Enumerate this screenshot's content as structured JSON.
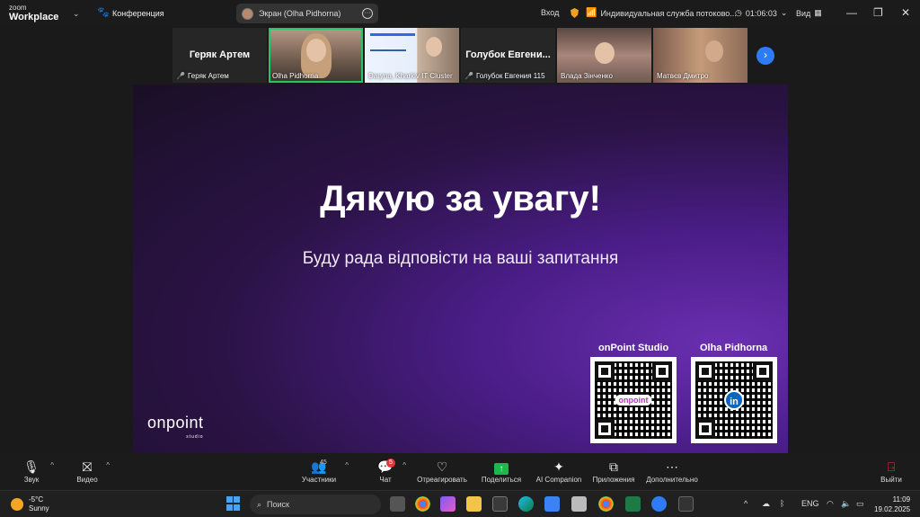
{
  "app": {
    "logo_line1": "zoom",
    "logo_line2": "Workplace"
  },
  "meeting": {
    "label": "Конференция"
  },
  "screen_share": {
    "label": "Экран (Olha Pidhorna)"
  },
  "header_right": {
    "login": "Вход",
    "service": "Индивидуальная служба потоково...",
    "timer": "01:06:03",
    "view": "Вид"
  },
  "participants_strip": [
    {
      "name": "Геряк Артем",
      "big_name": "Геряк Артем",
      "muted": true
    },
    {
      "name": "Olha Pidhorna",
      "big_name": "",
      "muted": false,
      "active": true
    },
    {
      "name": "Daryna, Kharkiv IT Cluster",
      "big_name": "",
      "muted": false
    },
    {
      "name": "Голубок Евгения 115",
      "big_name": "Голубок Евгени...",
      "muted": true
    },
    {
      "name": "Влада Зінченко",
      "big_name": "",
      "muted": false
    },
    {
      "name": "Матвєв Дмитро",
      "big_name": "",
      "muted": false
    }
  ],
  "slide": {
    "title": "Дякую за увагу!",
    "subtitle": "Буду рада відповісти на ваші запитання",
    "qr1_label": "onPoint Studio",
    "qr1_badge": "onpoint",
    "qr2_label": "Olha Pidhorna",
    "qr2_badge": "in",
    "brand": "onpoint",
    "brand_sub": "studio"
  },
  "toolbar": {
    "audio": "Звук",
    "video": "Видео",
    "participants": "Участники",
    "participants_count": "45",
    "chat": "Чат",
    "chat_badge": "5",
    "react": "Отреагировать",
    "share": "Поделиться",
    "ai": "AI Companion",
    "apps": "Приложения",
    "more": "Дополнительно",
    "leave": "Выйти"
  },
  "taskbar": {
    "temp": "-5°C",
    "weather": "Sunny",
    "search_placeholder": "Поиск",
    "lang": "ENG",
    "time": "11:09",
    "date": "19.02.2025"
  }
}
